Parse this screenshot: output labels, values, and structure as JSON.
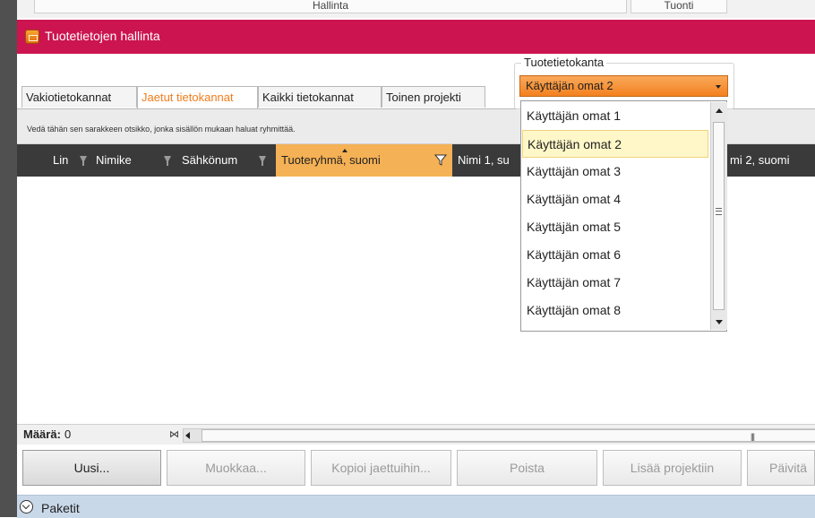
{
  "background_strip": {
    "left_label": "Hallinta",
    "right_label": "Tuonti"
  },
  "window": {
    "title": "Tuotetietojen hallinta",
    "accent_color": "#cc1450",
    "highlight_color": "#f5b155"
  },
  "tabs": [
    {
      "label": "Vakiotietokannat",
      "active": false
    },
    {
      "label": "Jaetut tietokannat",
      "active": true
    },
    {
      "label": "Kaikki tietokannat",
      "active": false
    },
    {
      "label": "Toinen projekti",
      "active": false
    }
  ],
  "group_hint": "Vedä tähän sen sarakkeen otsikko, jonka sisällön mukaan haluat ryhmittää.",
  "columns": [
    {
      "label": "Lin"
    },
    {
      "label": "Nimike"
    },
    {
      "label": "Sähkönum"
    },
    {
      "label": "Tuoteryhmä, suomi",
      "sorted": true,
      "filter_active": true
    },
    {
      "label": "Nimi 1, su"
    },
    {
      "label": "mi 2, suomi"
    }
  ],
  "footer": {
    "count_label": "Määrä:",
    "count_value": "0"
  },
  "buttons": [
    {
      "label": "Uusi...",
      "enabled": true
    },
    {
      "label": "Muokkaa...",
      "enabled": false
    },
    {
      "label": "Kopioi jaettuihin...",
      "enabled": false
    },
    {
      "label": "Poista",
      "enabled": false
    },
    {
      "label": "Lisää projektiin",
      "enabled": false
    },
    {
      "label": "Päivitä",
      "enabled": false
    }
  ],
  "packages": {
    "label": "Paketit"
  },
  "database": {
    "label": "Tuotetietokanta",
    "selected": "Käyttäjän omat 2",
    "options": [
      "Käyttäjän omat 1",
      "Käyttäjän omat 2",
      "Käyttäjän omat 3",
      "Käyttäjän omat 4",
      "Käyttäjän omat 5",
      "Käyttäjän omat 6",
      "Käyttäjän omat 7",
      "Käyttäjän omat 8"
    ]
  }
}
